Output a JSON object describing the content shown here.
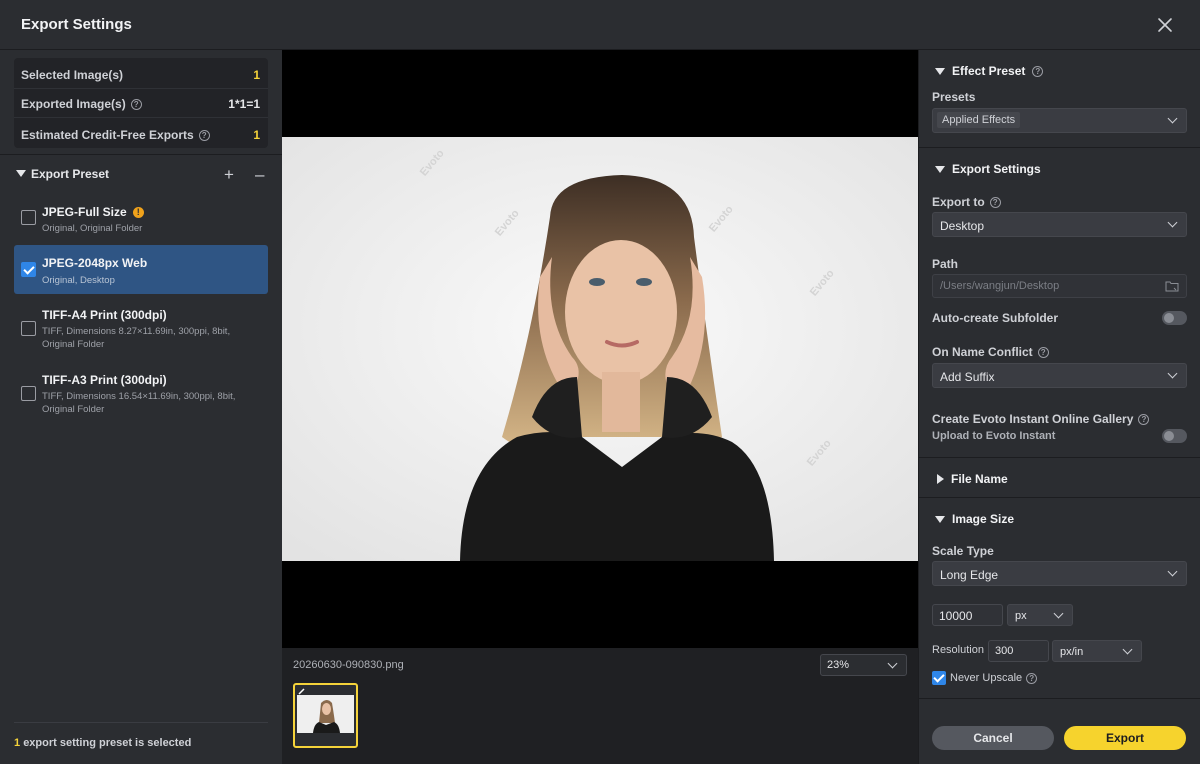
{
  "window": {
    "title": "Export Settings"
  },
  "stats": [
    {
      "label": "Selected Image(s)",
      "value": "1"
    },
    {
      "label": "Exported Image(s)",
      "value": "1*1=1"
    },
    {
      "label": "Estimated Credit-Free Exports",
      "value": "1"
    }
  ],
  "export_preset": {
    "label": "Export Preset",
    "items": [
      {
        "name": "JPEG-Full Size",
        "sub": "Original, Original Folder",
        "checked": false,
        "warning": true
      },
      {
        "name": "JPEG-2048px Web",
        "sub": "Original, Desktop",
        "checked": true
      },
      {
        "name": "TIFF-A4 Print (300dpi)",
        "sub": "TIFF, Dimensions 8.27×11.69in, 300ppi, 8bit, Original Folder",
        "checked": false
      },
      {
        "name": "TIFF-A3 Print (300dpi)",
        "sub": "TIFF, Dimensions 16.54×11.69in, 300ppi, 8bit, Original Folder",
        "checked": false
      }
    ],
    "footer_count": "1",
    "footer_text": "export setting preset is selected"
  },
  "preview": {
    "watermark": "Evoto",
    "filename": "20260630-090830.png",
    "zoom": "23%"
  },
  "effect_preset": {
    "header": "Effect Preset",
    "presets_label": "Presets",
    "presets_value": "Applied Effects"
  },
  "export_settings": {
    "header": "Export Settings",
    "export_to_label": "Export to",
    "export_to_value": "Desktop",
    "path_label": "Path",
    "path_value": "/Users/wangjun/Desktop",
    "auto_subfolder_label": "Auto-create Subfolder",
    "name_conflict_label": "On Name Conflict",
    "name_conflict_value": "Add Suffix",
    "gallery_label": "Create Evoto Instant Online Gallery",
    "gallery_sub": "Upload to Evoto Instant"
  },
  "file_name": {
    "header": "File Name"
  },
  "image_size": {
    "header": "Image Size",
    "scale_type_label": "Scale Type",
    "scale_type_value": "Long Edge",
    "size_value": "10000",
    "size_unit": "px",
    "resolution_label": "Resolution",
    "resolution_value": "300",
    "resolution_unit": "px/in",
    "never_upscale_label": "Never Upscale"
  },
  "actions": {
    "cancel": "Cancel",
    "export": "Export"
  }
}
